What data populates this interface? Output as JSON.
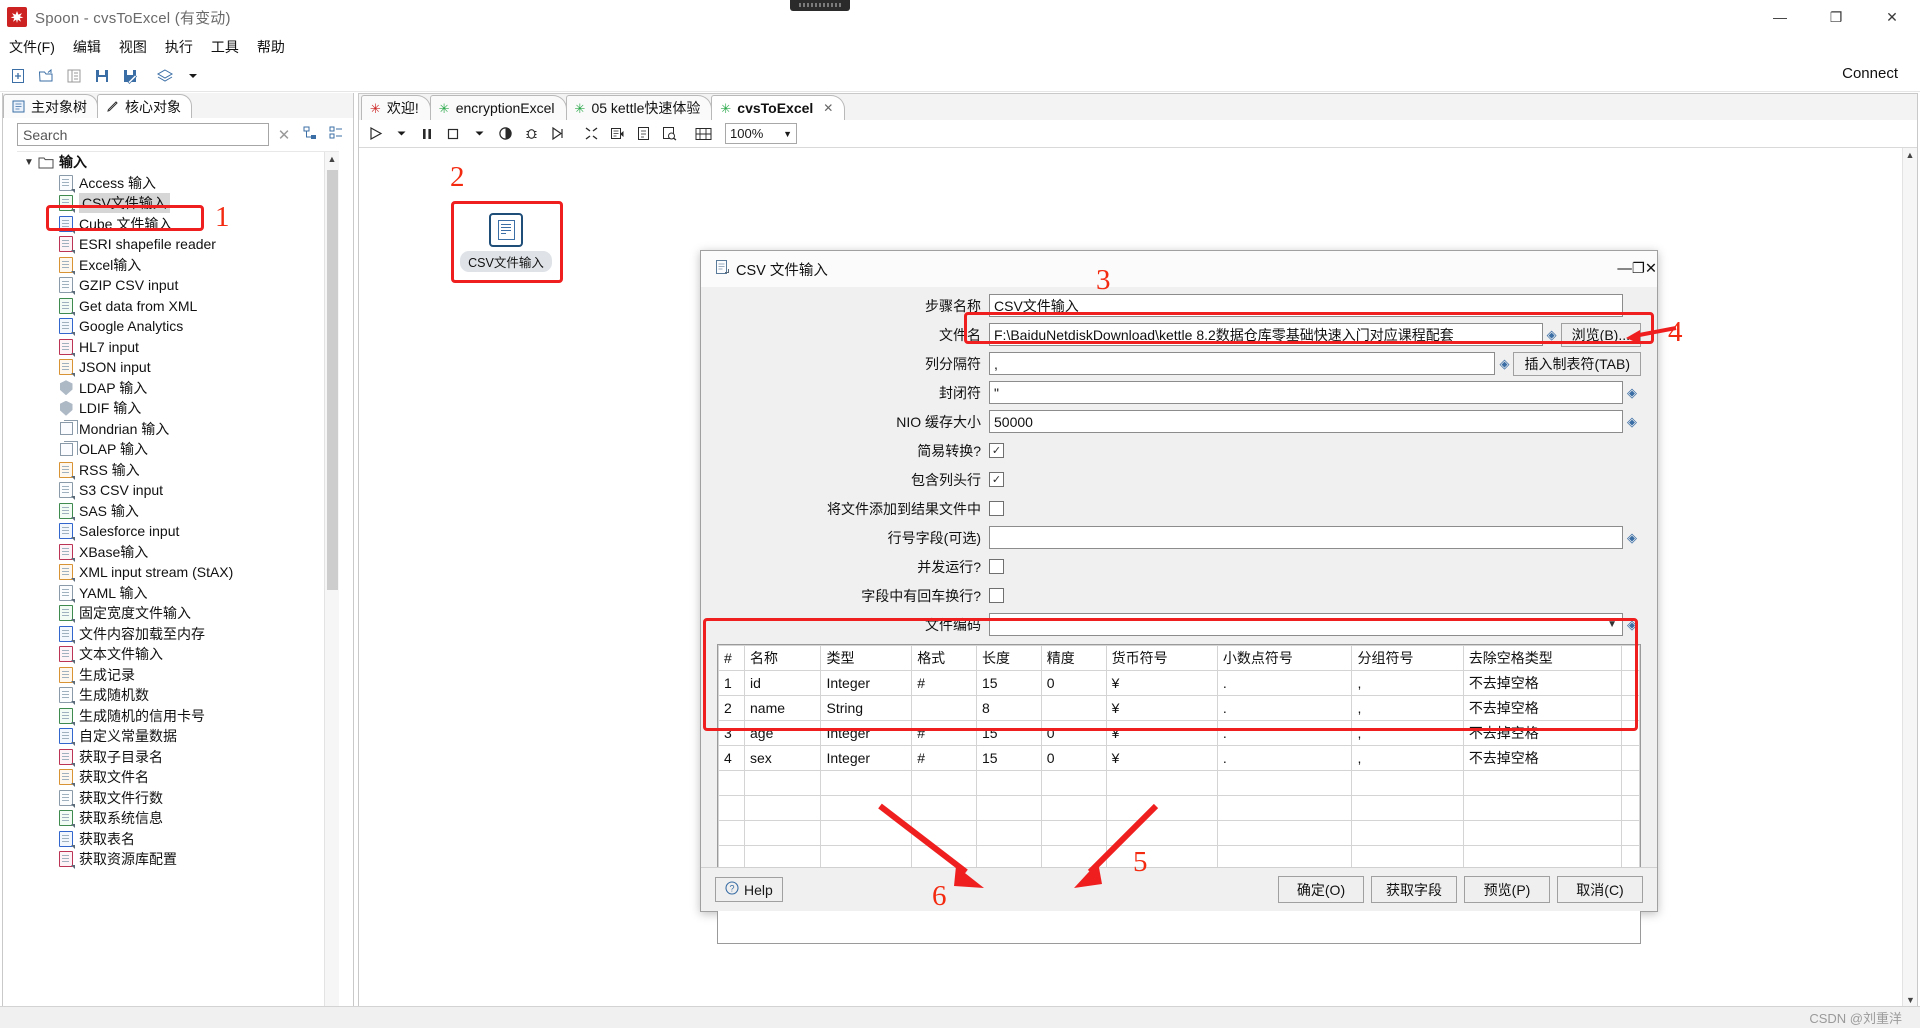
{
  "window": {
    "title": "Spoon - cvsToExcel (有变动)",
    "app_icon": "spoon-icon",
    "minimize": "—",
    "maximize": "❐",
    "close": "✕"
  },
  "menubar": {
    "items": [
      "文件(F)",
      "编辑",
      "视图",
      "执行",
      "工具",
      "帮助"
    ]
  },
  "toolbar": {
    "connect_label": "Connect",
    "icons": [
      "new-file-icon",
      "open-file-icon",
      "explore-icon",
      "save-icon",
      "save-as-icon",
      "layers-icon",
      "dropdown-arrow-icon"
    ]
  },
  "left_panel": {
    "tabs": [
      {
        "label": "主对象树",
        "icon": "tree-view-icon",
        "active": false
      },
      {
        "label": "核心对象",
        "icon": "pencil-icon",
        "active": true
      }
    ],
    "search": {
      "placeholder": "Search",
      "value": "",
      "clear_icon": "clear-x-icon",
      "expand_icon": "expand-all-icon",
      "collapse_icon": "collapse-all-icon"
    },
    "tree": {
      "root": {
        "label": "输入",
        "expanded": true,
        "icon": "folder-icon"
      },
      "items": [
        {
          "label": "Access 输入",
          "icon": "access-input-icon",
          "selected": false
        },
        {
          "label": "CSV文件输入",
          "icon": "csv-file-input-icon",
          "selected": true
        },
        {
          "label": "Cube 文件输入",
          "icon": "cube-file-input-icon",
          "selected": false
        },
        {
          "label": "ESRI shapefile reader",
          "icon": "esri-shapefile-icon",
          "selected": false
        },
        {
          "label": "Excel输入",
          "icon": "excel-input-icon",
          "selected": false
        },
        {
          "label": "GZIP CSV input",
          "icon": "gzip-csv-icon",
          "selected": false
        },
        {
          "label": "Get data from XML",
          "icon": "xml-data-icon",
          "selected": false
        },
        {
          "label": "Google Analytics",
          "icon": "google-analytics-icon",
          "selected": false
        },
        {
          "label": "HL7 input",
          "icon": "hl7-input-icon",
          "selected": false
        },
        {
          "label": "JSON input",
          "icon": "json-input-icon",
          "selected": false
        },
        {
          "label": "LDAP 输入",
          "icon": "ldap-input-icon",
          "selected": false
        },
        {
          "label": "LDIF 输入",
          "icon": "ldif-input-icon",
          "selected": false
        },
        {
          "label": "Mondrian 输入",
          "icon": "mondrian-input-icon",
          "selected": false
        },
        {
          "label": "OLAP 输入",
          "icon": "olap-input-icon",
          "selected": false
        },
        {
          "label": "RSS 输入",
          "icon": "rss-input-icon",
          "selected": false
        },
        {
          "label": "S3 CSV input",
          "icon": "s3-csv-icon",
          "selected": false
        },
        {
          "label": "SAS 输入",
          "icon": "sas-input-icon",
          "selected": false
        },
        {
          "label": "Salesforce input",
          "icon": "salesforce-icon",
          "selected": false
        },
        {
          "label": "XBase输入",
          "icon": "xbase-input-icon",
          "selected": false
        },
        {
          "label": "XML input stream (StAX)",
          "icon": "stax-input-icon",
          "selected": false
        },
        {
          "label": "YAML 输入",
          "icon": "yaml-input-icon",
          "selected": false
        },
        {
          "label": "固定宽度文件输入",
          "icon": "fixed-width-file-icon",
          "selected": false
        },
        {
          "label": "文件内容加载至内存",
          "icon": "load-file-memory-icon",
          "selected": false
        },
        {
          "label": "文本文件输入",
          "icon": "text-file-input-icon",
          "selected": false
        },
        {
          "label": "生成记录",
          "icon": "generate-rows-icon",
          "selected": false
        },
        {
          "label": "生成随机数",
          "icon": "generate-random-icon",
          "selected": false
        },
        {
          "label": "生成随机的信用卡号",
          "icon": "generate-credit-card-icon",
          "selected": false
        },
        {
          "label": "自定义常量数据",
          "icon": "constant-data-icon",
          "selected": false
        },
        {
          "label": "获取子目录名",
          "icon": "get-subfolder-icon",
          "selected": false
        },
        {
          "label": "获取文件名",
          "icon": "get-filenames-icon",
          "selected": false
        },
        {
          "label": "获取文件行数",
          "icon": "get-file-rowcount-icon",
          "selected": false
        },
        {
          "label": "获取系统信息",
          "icon": "get-system-info-icon",
          "selected": false
        },
        {
          "label": "获取表名",
          "icon": "get-table-names-icon",
          "selected": false
        },
        {
          "label": "获取资源库配置",
          "icon": "get-repository-config-icon",
          "selected": false
        }
      ]
    }
  },
  "canvas": {
    "tabs": [
      {
        "label": "欢迎!",
        "icon": "welcome-icon",
        "active": false,
        "closable": false
      },
      {
        "label": "encryptionExcel",
        "icon": "transformation-icon",
        "active": false,
        "closable": false
      },
      {
        "label": "05 kettle快速体验",
        "icon": "transformation-icon",
        "active": false,
        "closable": false
      },
      {
        "label": "cvsToExcel",
        "icon": "transformation-icon",
        "active": true,
        "closable": true
      }
    ],
    "toolbar": {
      "zoom": "100%",
      "icons": [
        "run-icon",
        "run-dropdown-icon",
        "pause-icon",
        "stop-icon",
        "stop-dropdown-icon",
        "preview-icon",
        "debug-icon",
        "replay-icon",
        "transformation-icon",
        "results-icon",
        "sql-icon",
        "inspect-icon",
        "grid-icon"
      ]
    },
    "step": {
      "label": "CSV文件输入",
      "icon": "csv-file-input-icon"
    }
  },
  "annotations": {
    "n1": "1",
    "n2": "2",
    "n3": "3",
    "n4": "4",
    "n5": "5",
    "n6": "6"
  },
  "dialog": {
    "title": "CSV 文件输入",
    "title_icon": "csv-file-input-icon",
    "minimize": "—",
    "maximize": "❐",
    "close": "✕",
    "fields": {
      "step_name": {
        "label": "步骤名称",
        "value": "CSV文件输入"
      },
      "file_name": {
        "label": "文件名",
        "value": "F:\\BaiduNetdiskDownload\\kettle 8.2数据仓库零基础快速入门对应课程配套",
        "browse_button": "浏览(B)..."
      },
      "delimiter": {
        "label": "列分隔符",
        "value": ",",
        "insert_tab_button": "插入制表符(TAB)"
      },
      "enclosure": {
        "label": "封闭符",
        "value": "\""
      },
      "nio_buffer": {
        "label": "NIO 缓存大小",
        "value": "50000"
      },
      "lazy_conversion": {
        "label": "简易转换?",
        "checked": true
      },
      "header_row": {
        "label": "包含列头行",
        "checked": true
      },
      "add_to_result": {
        "label": "将文件添加到结果文件中",
        "checked": false
      },
      "rownum_field": {
        "label": "行号字段(可选)",
        "value": ""
      },
      "running_parallel": {
        "label": "并发运行?",
        "checked": false
      },
      "newline_in_field": {
        "label": "字段中有回车换行?",
        "checked": false
      },
      "encoding": {
        "label": "文件编码",
        "value": ""
      }
    },
    "grid": {
      "columns": [
        "#",
        "名称",
        "类型",
        "格式",
        "长度",
        "精度",
        "货币符号",
        "小数点符号",
        "分组符号",
        "去除空格类型"
      ],
      "rows": [
        [
          "1",
          "id",
          "Integer",
          "#",
          "15",
          "0",
          "¥",
          ".",
          ",",
          "不去掉空格"
        ],
        [
          "2",
          "name",
          "String",
          "",
          "8",
          "",
          "¥",
          ".",
          ",",
          "不去掉空格"
        ],
        [
          "3",
          "age",
          "Integer",
          "#",
          "15",
          "0",
          "¥",
          ".",
          ",",
          "不去掉空格"
        ],
        [
          "4",
          "sex",
          "Integer",
          "#",
          "15",
          "0",
          "¥",
          ".",
          ",",
          "不去掉空格"
        ]
      ],
      "empty_rows": 5
    },
    "footer": {
      "help": "Help",
      "ok": "确定(O)",
      "get_fields": "获取字段",
      "preview": "预览(P)",
      "cancel": "取消(C)"
    }
  },
  "statusbar": {
    "watermark": "CSDN @刘重洋"
  },
  "colors": {
    "annotation_red": "#ef1f1f",
    "accent_blue": "#3b6ea5",
    "kettle_green": "#2aa84a"
  }
}
